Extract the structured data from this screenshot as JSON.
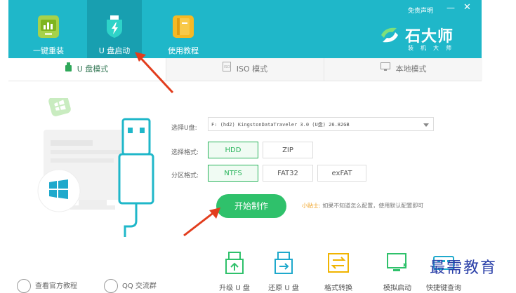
{
  "window": {
    "top_links": {
      "disclaimer": "免责声明"
    },
    "nav_tabs": [
      {
        "label": "一键重装",
        "icon": "monitor-chart-icon"
      },
      {
        "label": "U 盘启动",
        "icon": "usb-shield-icon"
      },
      {
        "label": "使用教程",
        "icon": "book-icon"
      }
    ],
    "brand": {
      "name": "石大师",
      "sub": "装机大师"
    },
    "sub_tabs": [
      {
        "label": "U 盘模式"
      },
      {
        "label": "ISO 模式"
      },
      {
        "label": "本地模式"
      }
    ]
  },
  "form": {
    "usb_label": "选择U盘:",
    "usb_value": "F: (hd2) KingstonDataTraveler 3.0 (U盘) 26.82GB",
    "format_label": "选择格式:",
    "format_options": [
      "HDD",
      "ZIP"
    ],
    "partition_label": "分区格式:",
    "partition_options": [
      "NTFS",
      "FAT32",
      "exFAT"
    ],
    "start_button": "开始制作",
    "tip_title": "小贴士:",
    "tip_text": "如果不知道怎么配置，使用默认配置即可"
  },
  "tools": [
    {
      "label": "升级 U 盘"
    },
    {
      "label": "还原 U 盘"
    },
    {
      "label": "格式转换"
    },
    {
      "label": "模拟启动"
    },
    {
      "label": "快捷键查询"
    }
  ],
  "links": {
    "website": "查看官方教程",
    "qq": "QQ 交流群"
  },
  "watermark": "最需教育",
  "colors": {
    "teal": "#1fb7c9",
    "green": "#2fc16b",
    "orange_arrow": "#e23d1d"
  }
}
